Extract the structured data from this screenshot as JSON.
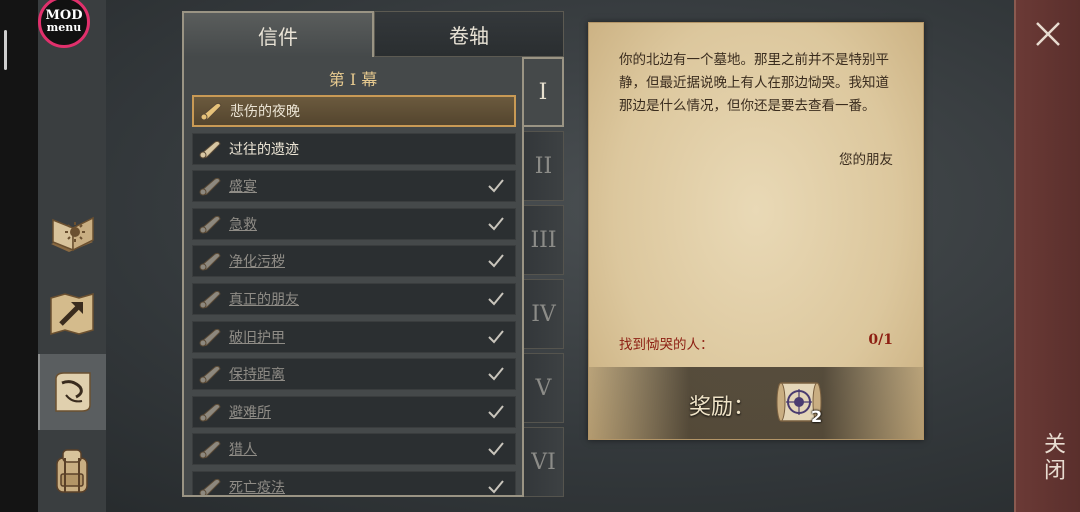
{
  "mod_menu": {
    "line1": "MOD",
    "line2": "menu"
  },
  "tabs": [
    {
      "label": "信件",
      "active": true
    },
    {
      "label": "卷轴",
      "active": false
    }
  ],
  "act_title": "第 I 幕",
  "quests": [
    {
      "label": "悲伤的夜晚",
      "state": "selected"
    },
    {
      "label": "过往的遗迹",
      "state": "active"
    },
    {
      "label": "盛宴",
      "state": "done"
    },
    {
      "label": "急救",
      "state": "done"
    },
    {
      "label": "净化污秽",
      "state": "done"
    },
    {
      "label": "真正的朋友",
      "state": "done"
    },
    {
      "label": "破旧护甲",
      "state": "done"
    },
    {
      "label": "保持距离",
      "state": "done"
    },
    {
      "label": "避难所",
      "state": "done"
    },
    {
      "label": "猎人",
      "state": "done"
    },
    {
      "label": "死亡疫法",
      "state": "done"
    }
  ],
  "acts": [
    "I",
    "II",
    "III",
    "IV",
    "V",
    "VI"
  ],
  "letter": {
    "body": "你的北边有一个墓地。那里之前并不是特别平静，但最近据说晚上有人在那边恸哭。我知道那边是什么情况，但你还是要去查看一番。",
    "signature": "您的朋友",
    "objective": "找到恸哭的人：",
    "objective_count": "0/1",
    "reward_label": "奖励：",
    "reward_qty": "2"
  },
  "close": {
    "label": "关闭"
  },
  "colors": {
    "accent": "#c99a55",
    "objective": "#8d1e12",
    "parchment": "#dcc79d"
  }
}
